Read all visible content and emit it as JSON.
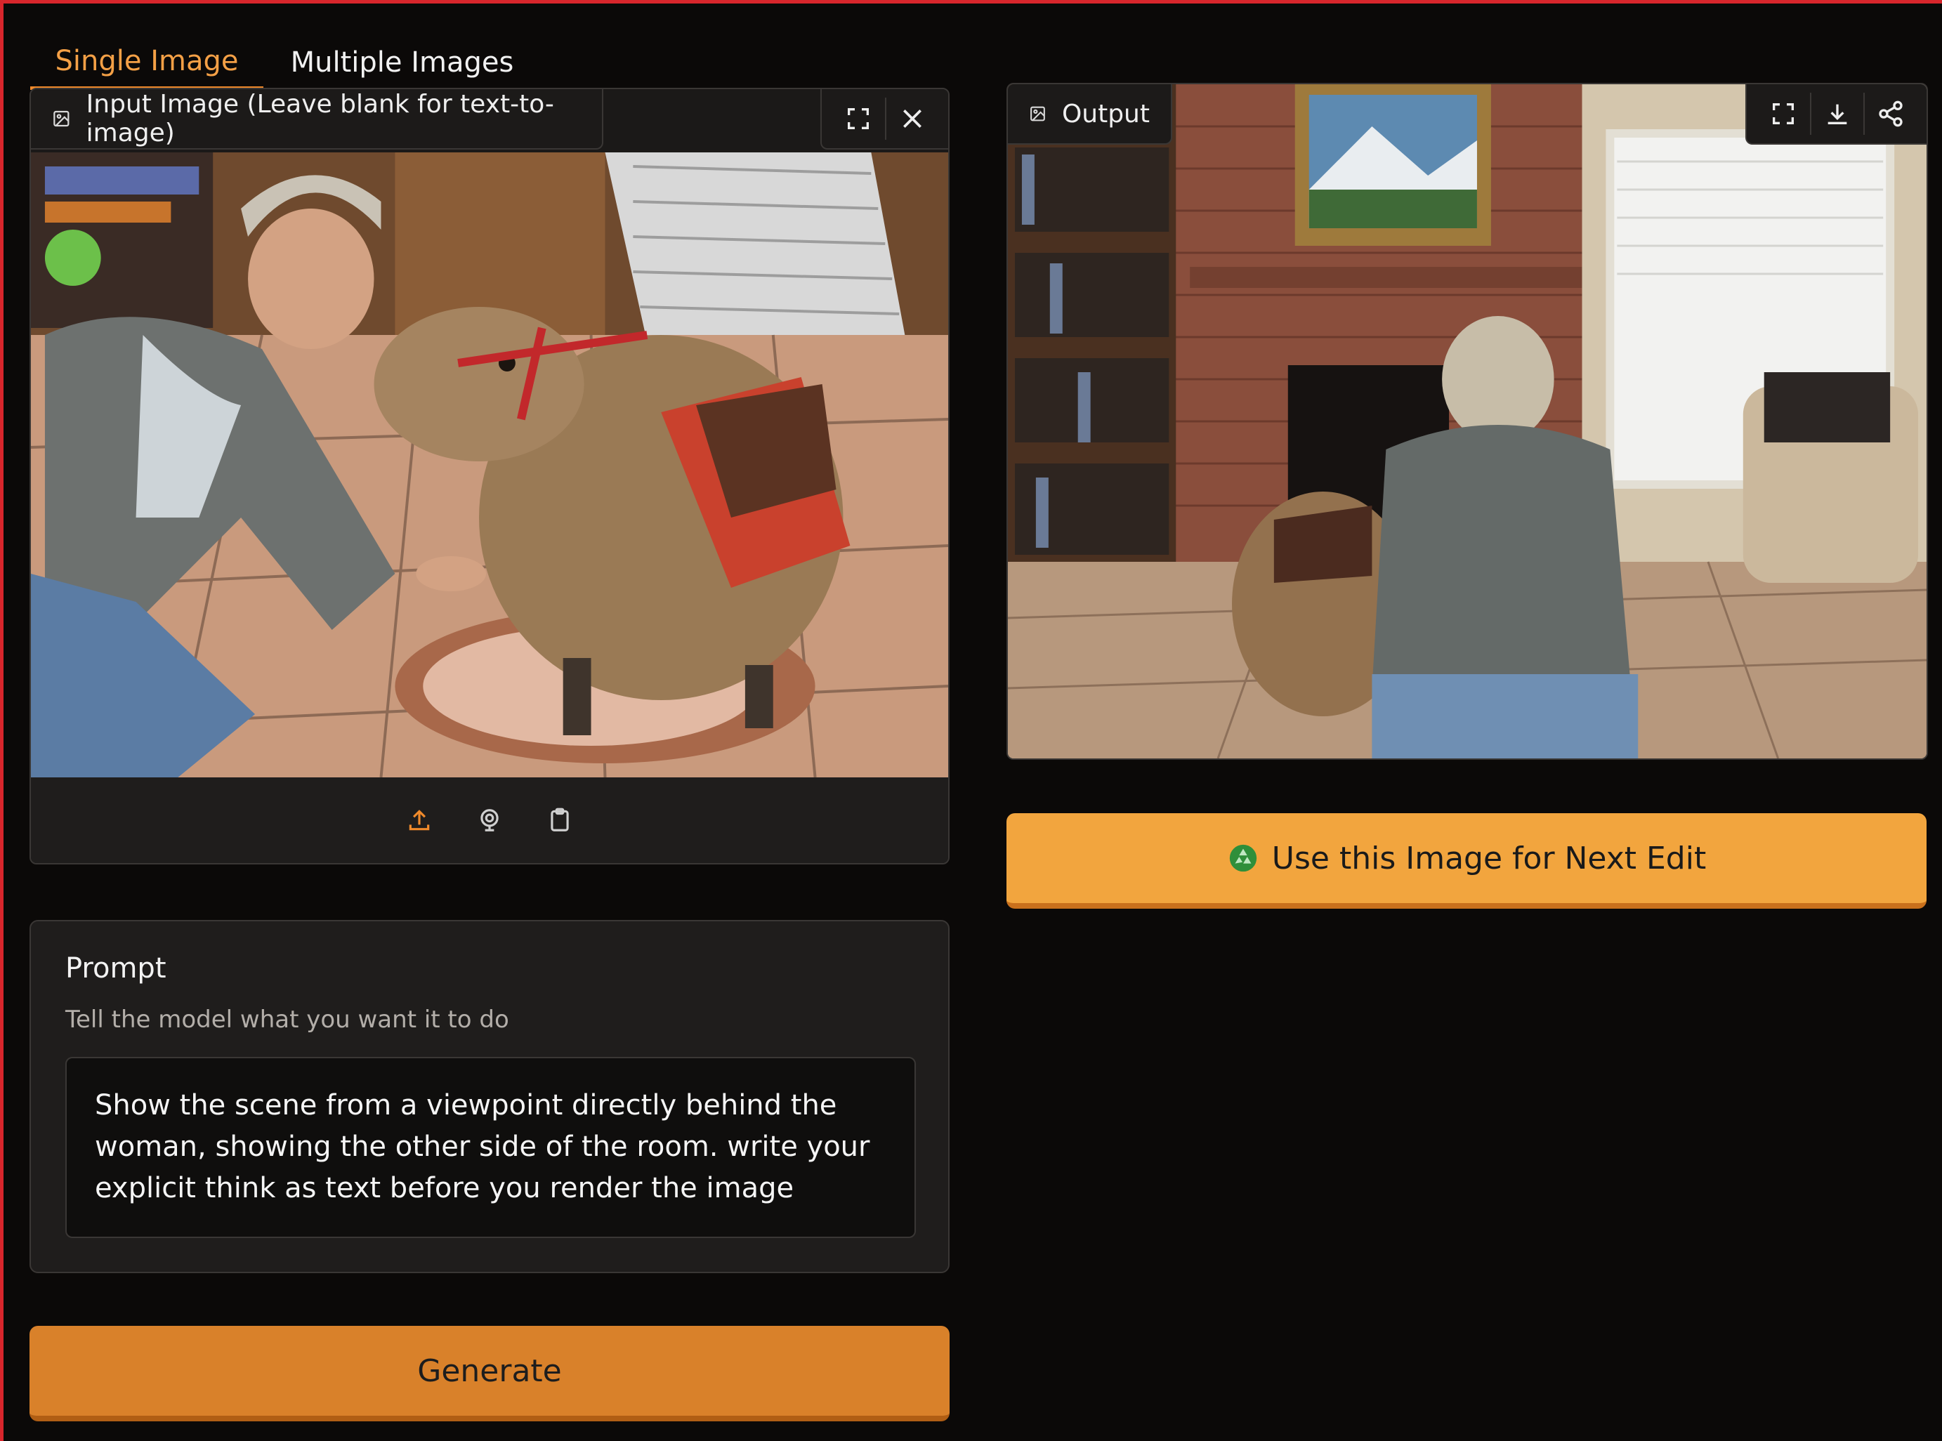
{
  "tabs": [
    {
      "label": "Single Image",
      "active": true
    },
    {
      "label": "Multiple Images",
      "active": false
    }
  ],
  "input_image": {
    "label": "Input Image (Leave blank for text-to-image)",
    "icons": [
      "image-icon",
      "fullscreen-icon",
      "close-icon"
    ],
    "source_icons": [
      "upload-icon",
      "webcam-icon",
      "clipboard-icon"
    ]
  },
  "output_image": {
    "label": "Output",
    "icons": [
      "image-icon",
      "fullscreen-icon",
      "download-icon",
      "share-icon"
    ]
  },
  "use_image_button": {
    "label": "Use this Image for Next Edit",
    "icon": "recycle-icon"
  },
  "prompt": {
    "title": "Prompt",
    "info": "Tell the model what you want it to do",
    "value": "Show the scene from a viewpoint directly behind the\nwoman, showing the other side of the room. write your\nexplicit think as text before you render the image"
  },
  "generate_button": {
    "label": "Generate"
  },
  "colors": {
    "accent": "#f2a53e",
    "generate": "#d9812a",
    "active_tab": "#f4a046",
    "background": "#0b0908",
    "panel": "#1f1d1c"
  }
}
